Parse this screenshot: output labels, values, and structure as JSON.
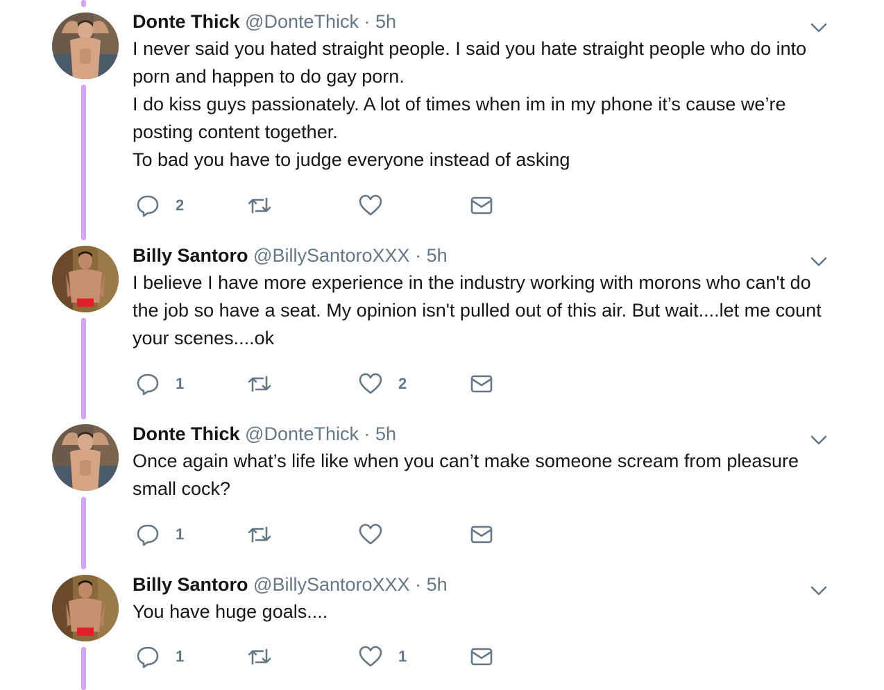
{
  "colors": {
    "thread_line": "#d6a5f2",
    "name": "#14171a",
    "meta": "#657786",
    "icon": "#657786"
  },
  "tweets": [
    {
      "name": "Donte Thick",
      "handle": "@DonteThick",
      "sep": "·",
      "time": "5h",
      "avatar": "donte-avatar",
      "lines": [
        "I never said you hated straight people. I said you hate straight people who do into porn and happen to do gay porn.",
        "I do kiss guys passionately. A lot of times when im in my phone it’s cause we’re posting content together.",
        "To bad you have to judge everyone instead of asking"
      ],
      "reply_count": "2",
      "retweet_count": "",
      "like_count": ""
    },
    {
      "name": "Billy Santoro",
      "handle": "@BillySantoroXXX",
      "sep": "·",
      "time": "5h",
      "avatar": "billy-avatar",
      "lines": [
        "I believe I have more experience in the industry working with morons who can't do the job so have a seat.  My opinion isn't pulled out of this air.  But wait....let me count your scenes....ok"
      ],
      "reply_count": "1",
      "retweet_count": "",
      "like_count": "2"
    },
    {
      "name": "Donte Thick",
      "handle": "@DonteThick",
      "sep": "·",
      "time": "5h",
      "avatar": "donte-avatar",
      "lines": [
        "Once again what’s life like when you can’t make someone scream from pleasure small cock?"
      ],
      "reply_count": "1",
      "retweet_count": "",
      "like_count": ""
    },
    {
      "name": "Billy Santoro",
      "handle": "@BillySantoroXXX",
      "sep": "·",
      "time": "5h",
      "avatar": "billy-avatar",
      "lines": [
        "You have huge goals...."
      ],
      "reply_count": "1",
      "retweet_count": "",
      "like_count": "1"
    }
  ],
  "icons": {
    "reply": "reply-icon",
    "retweet": "retweet-icon",
    "like": "heart-icon",
    "dm": "envelope-icon",
    "caret": "chevron-down-icon"
  }
}
